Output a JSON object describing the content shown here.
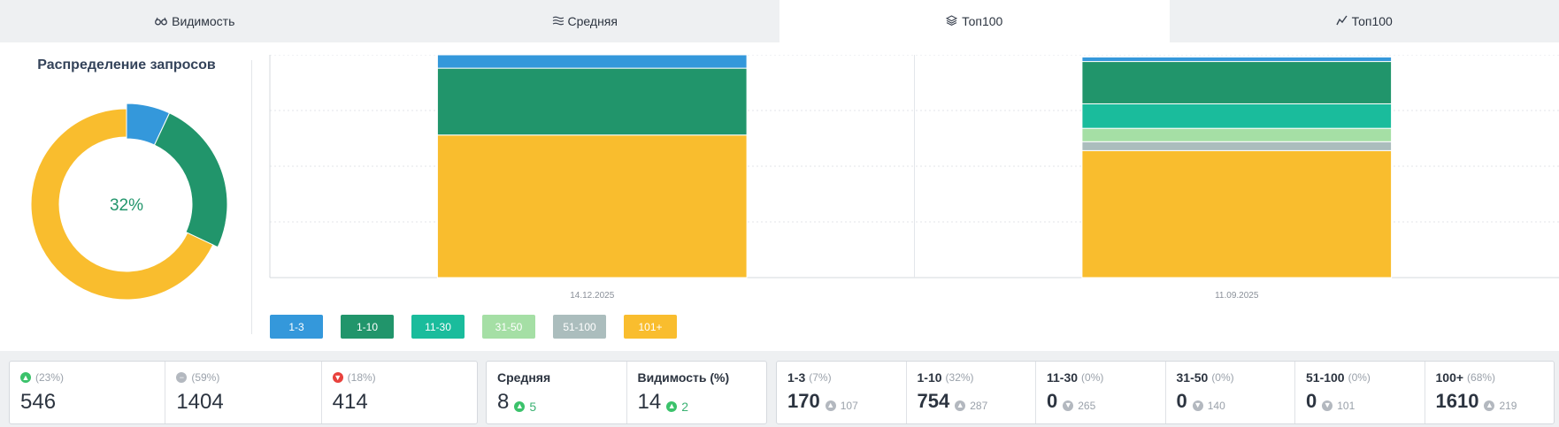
{
  "tabs": [
    {
      "label": "Видимость",
      "icon": "glasses-icon",
      "active": false
    },
    {
      "label": "Средняя",
      "icon": "lines-icon",
      "active": false
    },
    {
      "label": "Топ100",
      "icon": "layers-icon",
      "active": true
    },
    {
      "label": "Топ100",
      "icon": "line-chart-icon",
      "active": false
    }
  ],
  "donut": {
    "title": "Распределение запросов",
    "center_label": "32%",
    "segments": [
      {
        "name": "1-3",
        "percent": 7,
        "color": "#3498db"
      },
      {
        "name": "1-10",
        "percent": 25,
        "color": "#21956b"
      },
      {
        "name": "101+",
        "percent": 68,
        "color": "#f9bd2e"
      }
    ]
  },
  "chart_data": {
    "type": "bar",
    "stacked": true,
    "categories": [
      "14.12.2025",
      "11.09.2025"
    ],
    "series": [
      {
        "name": "101+",
        "color": "#f9bd2e",
        "values": [
          64,
          57
        ]
      },
      {
        "name": "51-100",
        "color": "#abbdbd",
        "values": [
          0,
          4
        ]
      },
      {
        "name": "31-50",
        "color": "#a5dfa5",
        "values": [
          0,
          6
        ]
      },
      {
        "name": "11-30",
        "color": "#1abc9c",
        "values": [
          0,
          11
        ]
      },
      {
        "name": "1-10",
        "color": "#21956b",
        "values": [
          30,
          19
        ]
      },
      {
        "name": "1-3",
        "color": "#3498db",
        "values": [
          6,
          2
        ]
      }
    ],
    "ylim": [
      0,
      100
    ],
    "grid": true
  },
  "legend": [
    {
      "label": "1-3",
      "color": "#3498db"
    },
    {
      "label": "1-10",
      "color": "#21956b"
    },
    {
      "label": "11-30",
      "color": "#1abc9c"
    },
    {
      "label": "31-50",
      "color": "#a5dfa5"
    },
    {
      "label": "51-100",
      "color": "#abbdbd"
    },
    {
      "label": "101+",
      "color": "#f9bd2e"
    }
  ],
  "stats_left": [
    {
      "icon": "arrow-up-circle-icon",
      "pct": "(23%)",
      "value": "546"
    },
    {
      "icon": "minus-circle-icon",
      "pct": "(59%)",
      "value": "1404"
    },
    {
      "icon": "arrow-down-circle-icon",
      "pct": "(18%)",
      "value": "414"
    }
  ],
  "stats_mid": [
    {
      "title": "Средняя",
      "value": "8",
      "delta": "5"
    },
    {
      "title": "Видимость (%)",
      "value": "14",
      "delta": "2"
    }
  ],
  "stats_right": [
    {
      "label": "1-3",
      "pct": "(7%)",
      "value": "170",
      "delta": "107"
    },
    {
      "label": "1-10",
      "pct": "(32%)",
      "value": "754",
      "delta": "287"
    },
    {
      "label": "11-30",
      "pct": "(0%)",
      "value": "0",
      "delta": "265"
    },
    {
      "label": "31-50",
      "pct": "(0%)",
      "value": "0",
      "delta": "140"
    },
    {
      "label": "51-100",
      "pct": "(0%)",
      "value": "0",
      "delta": "101"
    },
    {
      "label": "100+",
      "pct": "(68%)",
      "value": "1610",
      "delta": "219"
    }
  ]
}
